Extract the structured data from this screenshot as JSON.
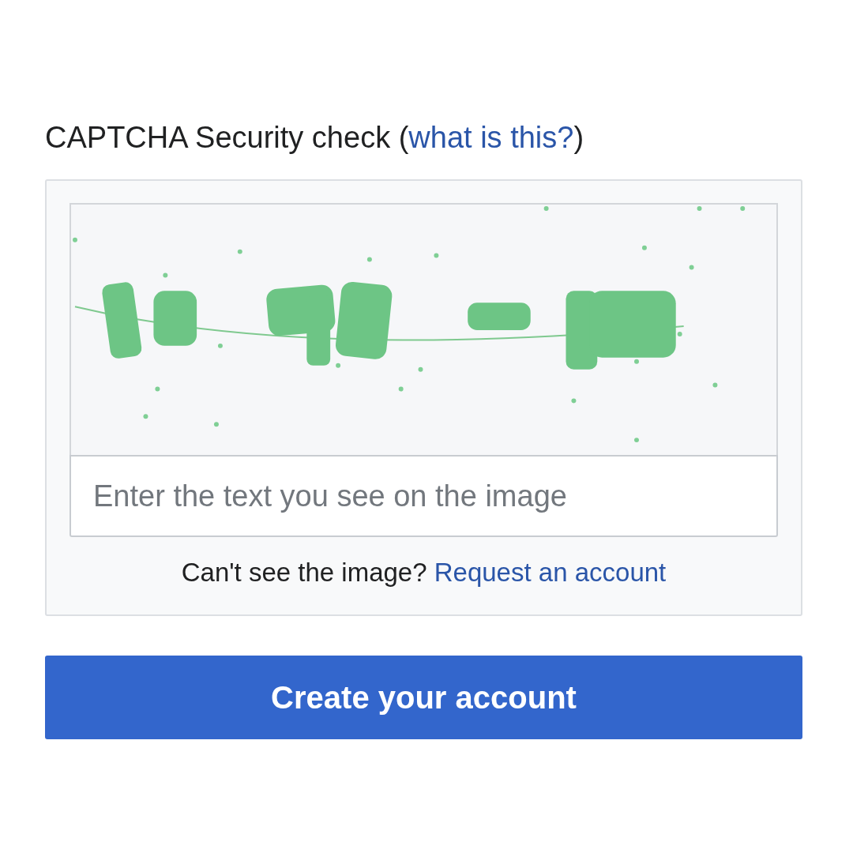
{
  "heading": {
    "text": "CAPTCHA Security check (",
    "link": "what is this?",
    "text_after": ")"
  },
  "captcha": {
    "input": {
      "placeholder": "Enter the text you see on the image"
    },
    "help": {
      "text": "Can't see the image?",
      "link": "Request an account"
    }
  },
  "submit_button": "Create your account"
}
